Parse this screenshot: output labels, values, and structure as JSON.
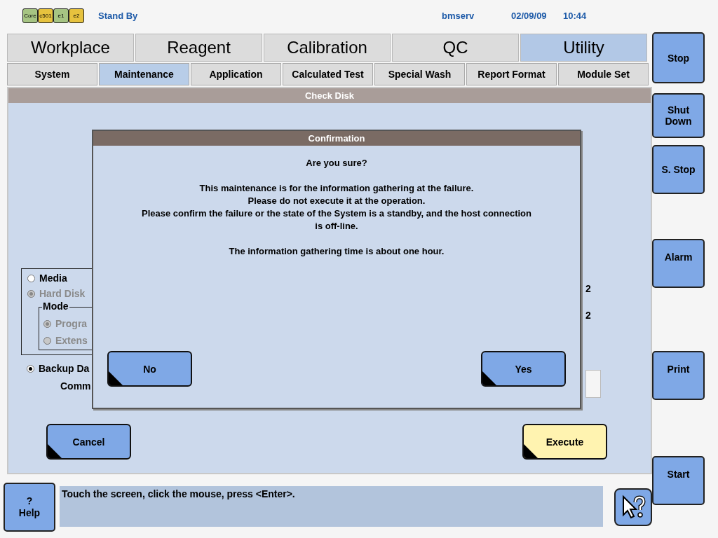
{
  "status_bar": {
    "modules": [
      {
        "label": "Core",
        "color": "#a6c483"
      },
      {
        "label": "c501",
        "color": "#e6c23e"
      },
      {
        "label": "e1",
        "color": "#a6c483"
      },
      {
        "label": "e2",
        "color": "#e6c23e"
      }
    ],
    "status": "Stand By",
    "user": "bmserv",
    "date": "02/09/09",
    "time": "10:44"
  },
  "main_tabs": [
    {
      "label": "Workplace",
      "selected": false
    },
    {
      "label": "Reagent",
      "selected": false
    },
    {
      "label": "Calibration",
      "selected": false
    },
    {
      "label": "QC",
      "selected": false
    },
    {
      "label": "Utility",
      "selected": true
    }
  ],
  "sub_tabs": [
    {
      "label": "System",
      "selected": false
    },
    {
      "label": "Maintenance",
      "selected": true
    },
    {
      "label": "Application",
      "selected": false
    },
    {
      "label": "Calculated Test",
      "selected": false
    },
    {
      "label": "Special Wash",
      "selected": false
    },
    {
      "label": "Report Format",
      "selected": false
    },
    {
      "label": "Module Set",
      "selected": false
    }
  ],
  "panel": {
    "title": "Check Disk",
    "options": [
      {
        "label": "Media",
        "selected": false,
        "disabled": false
      },
      {
        "label": "Hard Disk",
        "selected": true,
        "disabled": true
      }
    ],
    "mode_group": {
      "title": "Mode",
      "options": [
        {
          "label": "Progra",
          "selected": true,
          "disabled": true
        },
        {
          "label": "Extens",
          "selected": false,
          "disabled": true
        }
      ]
    },
    "backup": {
      "label": "Backup Da",
      "selected": true,
      "disabled": false
    },
    "comment_label": "Comm",
    "digits": [
      "2",
      "2"
    ],
    "cancel": "Cancel",
    "execute": "Execute"
  },
  "dialog": {
    "title": "Confirmation",
    "question": "Are you sure?",
    "lines": [
      "This maintenance is for the information gathering at the failure.",
      "Please do not execute it at the operation.",
      "Please confirm the failure or the state of the System is a standby, and the host connection is off-line."
    ],
    "note": "The information gathering time is about one hour.",
    "no": "No",
    "yes": "Yes"
  },
  "side_buttons": [
    "Stop",
    "Shut Down",
    "S. Stop",
    "Alarm",
    "Print",
    "Start"
  ],
  "help_button": {
    "mark": "?",
    "label": "Help"
  },
  "message": "Touch the screen, click the mouse, press <Enter>."
}
